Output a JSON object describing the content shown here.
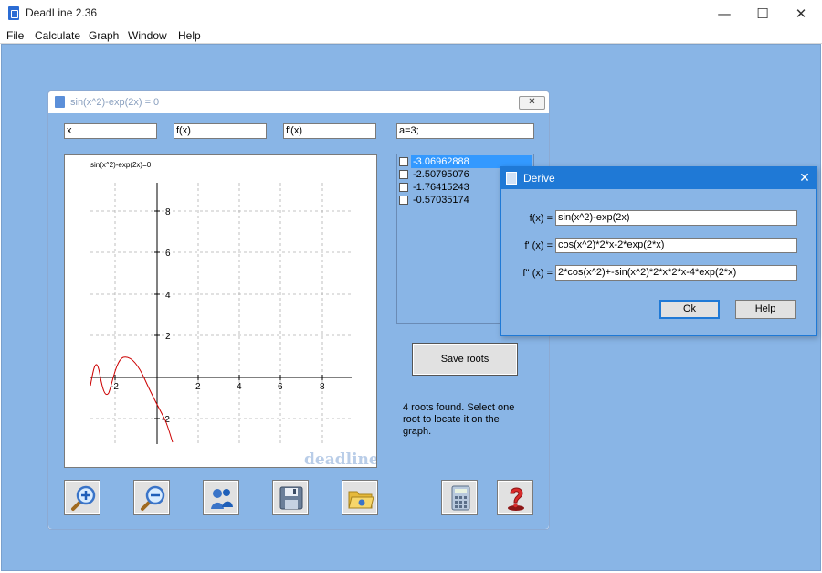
{
  "app": {
    "title": "DeadLine 2.36"
  },
  "window_controls": {
    "minimize": "—",
    "maximize": "☐",
    "close": "✕"
  },
  "menu": [
    "File",
    "Calculate",
    "Graph",
    "Window",
    "Help"
  ],
  "child_window": {
    "title": "sin(x^2)-exp(2x) = 0",
    "close_label": "✕",
    "inputs": {
      "x": "x",
      "fx": "f(x)",
      "dfx": "f'(x)",
      "params": "a=3;"
    },
    "graph": {
      "title": "sin(x^2)-exp(2x)=0",
      "watermark": "deadline",
      "x_ticks": [
        "-2",
        "2",
        "4",
        "6",
        "8"
      ],
      "y_ticks": [
        "8",
        "6",
        "4",
        "2",
        "-2"
      ]
    },
    "roots": [
      {
        "value": "-3.06962888",
        "selected": true
      },
      {
        "value": "-2.50795076",
        "selected": false
      },
      {
        "value": "-1.76415243",
        "selected": false
      },
      {
        "value": "-0.57035174",
        "selected": false
      }
    ],
    "save_roots_label": "Save roots",
    "status": "4 roots found. Select one root to locate it on the graph.",
    "toolbar": [
      "zoom-in-icon",
      "zoom-out-icon",
      "pan-icon",
      "save-icon",
      "open-icon",
      "calculator-icon",
      "help-icon"
    ]
  },
  "derive_dialog": {
    "title": "Derive",
    "close_label": "✕",
    "fx_label": "f(x) =",
    "fx_value": "sin(x^2)-exp(2x)",
    "dfx_label": "f' (x) =",
    "dfx_value": "cos(x^2)*2*x-2*exp(2*x)",
    "ddfx_label": "f'' (x) =",
    "ddfx_value": "2*cos(x^2)+-sin(x^2)*2*x*2*x-4*exp(2*x)",
    "ok_label": "Ok",
    "help_label": "Help"
  },
  "colors": {
    "workspace": "#89b5e6",
    "accent": "#1f79d6",
    "curve": "#cc0000",
    "selection": "#3399ff"
  }
}
